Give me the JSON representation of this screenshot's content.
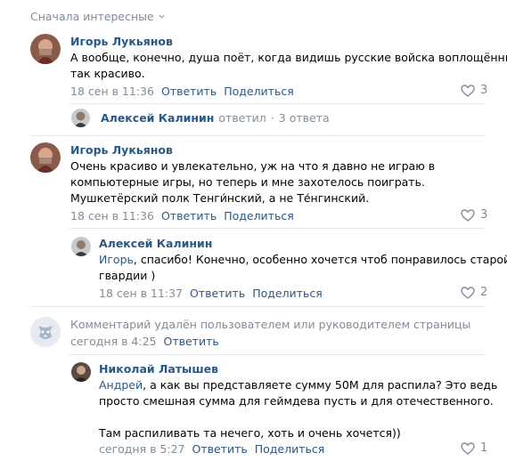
{
  "sort": {
    "label": "Сначала интересные"
  },
  "comments": [
    {
      "author": "Игорь Лукьянов",
      "lines": [
        "А вообще, конечно, душа поёт, когда видишь русские войска воплощённые",
        "так красиво."
      ],
      "date": "18 сен в 11:36",
      "reply": "Ответить",
      "share": "Поделиться",
      "likes": "3",
      "thread": {
        "author": "Алексей Калинин",
        "verb": "ответил",
        "dot": "·",
        "count": "3 ответа"
      }
    },
    {
      "author": "Игорь Лукьянов",
      "lines": [
        "Очень красиво и увлекательно, уж на что я давно не играю в",
        "компьютерные игры, но теперь и мне захотелось поиграть.",
        "Мушкетёрский полк Тенги́нский, а не Те́нгинский."
      ],
      "date": "18 сен в 11:36",
      "reply": "Ответить",
      "share": "Поделиться",
      "likes": "3"
    },
    {
      "author": "Алексей Калинин",
      "mention": "Игорь",
      "lines": [
        ", спасибо! Конечно, особенно хочется чтоб понравилось старой",
        "гвардии )"
      ],
      "date": "18 сен в 11:37",
      "reply": "Ответить",
      "share": "Поделиться",
      "likes": "2"
    },
    {
      "deleted_text": "Комментарий удалён пользователем или руководителем страницы",
      "date": "сегодня в 4:25",
      "reply": "Ответить"
    },
    {
      "author": "Николай Латышев",
      "mention": "Андрей",
      "lines": [
        ", а как вы представляете сумму 50М для распила? Это ведь",
        "просто смешная сумма для геймдева пусть и для отечественного.",
        "",
        "Там распиливать та нечего, хоть и очень хочется))"
      ],
      "date": "сегодня в 5:27",
      "reply": "Ответить",
      "share": "Поделиться",
      "likes": "1"
    }
  ],
  "colors": {
    "link": "#2a5885",
    "muted": "#818c99",
    "separator": "#e7e8ec"
  }
}
